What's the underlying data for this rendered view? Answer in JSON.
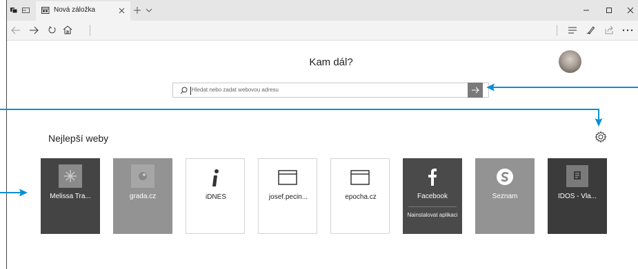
{
  "browser": {
    "tab_title": "Nová záložka",
    "window_controls": [
      "minimize-icon",
      "maximize-icon",
      "close-icon"
    ],
    "toolbar_icons": [
      "hub-icon",
      "pen-icon",
      "share-icon",
      "more-icon"
    ]
  },
  "newtab": {
    "headline": "Kam dál?",
    "search_placeholder": "Hledat nebo zadat webovou adresu",
    "section_title": "Nejlepší weby",
    "tiles": [
      {
        "label": "Melissa Tra...",
        "style": "dark"
      },
      {
        "label": "grada.cz",
        "style": "gray"
      },
      {
        "label": "iDNES",
        "style": "white"
      },
      {
        "label": "josef.pecin...",
        "style": "white"
      },
      {
        "label": "epocha.cz",
        "style": "white"
      },
      {
        "label": "Facebook",
        "style": "dark",
        "sub": "Nainstalovat aplikaci"
      },
      {
        "label": "Seznam",
        "style": "gray"
      },
      {
        "label": "IDOS - Vla...",
        "style": "dark"
      }
    ]
  },
  "colors": {
    "accent": "#0a8fd6",
    "tab_bar": "#e6e6e6",
    "tile_dark": "#444444",
    "tile_gray": "#939393"
  }
}
